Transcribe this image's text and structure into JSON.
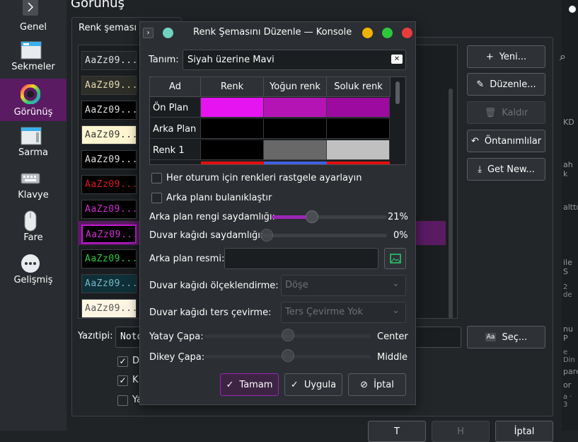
{
  "sidebar": {
    "items": [
      {
        "label": "Genel",
        "icon": "chevron-right-icon"
      },
      {
        "label": "Sekmeler",
        "icon": "tabs-icon"
      },
      {
        "label": "Görünüş",
        "icon": "appearance-icon"
      },
      {
        "label": "Sarma",
        "icon": "scroll-icon"
      },
      {
        "label": "Klavye",
        "icon": "keyboard-icon"
      },
      {
        "label": "Fare",
        "icon": "mouse-icon"
      },
      {
        "label": "Gelişmiş",
        "icon": "more-icon"
      }
    ]
  },
  "main": {
    "page_title": "Görünüş",
    "tab_label": "Renk şeması v",
    "swatch_text": "AaZz09...",
    "buttons": {
      "new": "Yeni...",
      "edit": "Düzenle...",
      "remove": "Kaldır",
      "defaults": "Öntanımlılar",
      "get_new": "Get New..."
    },
    "font_label": "Yazıtipi:",
    "font_value": "Noto",
    "choose_button": "Seç...",
    "checkbox_fragments": [
      "D",
      "K",
      "Ya"
    ]
  },
  "dialog": {
    "title": "Renk Şemasını Düzenle — Konsole",
    "description_label": "Tanım:",
    "description_value": "Siyah üzerine Mavi",
    "table": {
      "headers": [
        "Ad",
        "Renk",
        "Yoğun renk",
        "Soluk renk"
      ],
      "rows": [
        {
          "name": "Ön Plan",
          "colors": [
            "#e614f0",
            "#b414b4",
            "#9c0aa0"
          ]
        },
        {
          "name": "Arka Plan",
          "colors": [
            "#000000",
            "#000000",
            "#000000"
          ]
        },
        {
          "name": "Renk 1",
          "colors": [
            "#000000",
            "#686868",
            "#c0c0c0"
          ]
        }
      ]
    },
    "random_colors_label": "Her oturum için renkleri rastgele ayarlayın",
    "blur_label": "Arka planı bulanıklaştır",
    "bg_opacity_label": "Arka plan rengi saydamlığı:",
    "bg_opacity_value": "21%",
    "bg_opacity_fraction": 0.21,
    "wallpaper_opacity_label": "Duvar kağıdı saydamlığı:",
    "wallpaper_opacity_value": "0%",
    "wallpaper_opacity_fraction": 0.0,
    "bg_image_label": "Arka plan resmi:",
    "bg_image_value": "",
    "scaling_label": "Duvar kağıdı ölçeklendirme:",
    "scaling_value": "Döşe",
    "flip_label": "Duvar kağıdı ters çevirme:",
    "flip_value": "Ters Çevirme Yok",
    "h_anchor_label": "Yatay Çapa:",
    "h_anchor_value": "Center",
    "v_anchor_label": "Dikey Çapa:",
    "v_anchor_value": "Middle",
    "ok_button": "Tamam",
    "apply_button": "Uygula",
    "cancel_button": "İptal"
  },
  "bottom": {
    "fragments": [
      "T",
      "H",
      "İptal"
    ]
  },
  "right_strip": {
    "fragments": [
      "KD",
      "ah k",
      "alttı",
      "ile S",
      "2 de",
      "nu P",
      "e Din",
      "pare",
      "or",
      "a · 3"
    ]
  },
  "colors": {
    "accent": "#9b26b6",
    "active_sidebar": "#5a1b63",
    "window_bg": "#2b2e32",
    "close": "#e93d3d",
    "minimize": "#f0b400",
    "maximize": "#2dc83c"
  }
}
